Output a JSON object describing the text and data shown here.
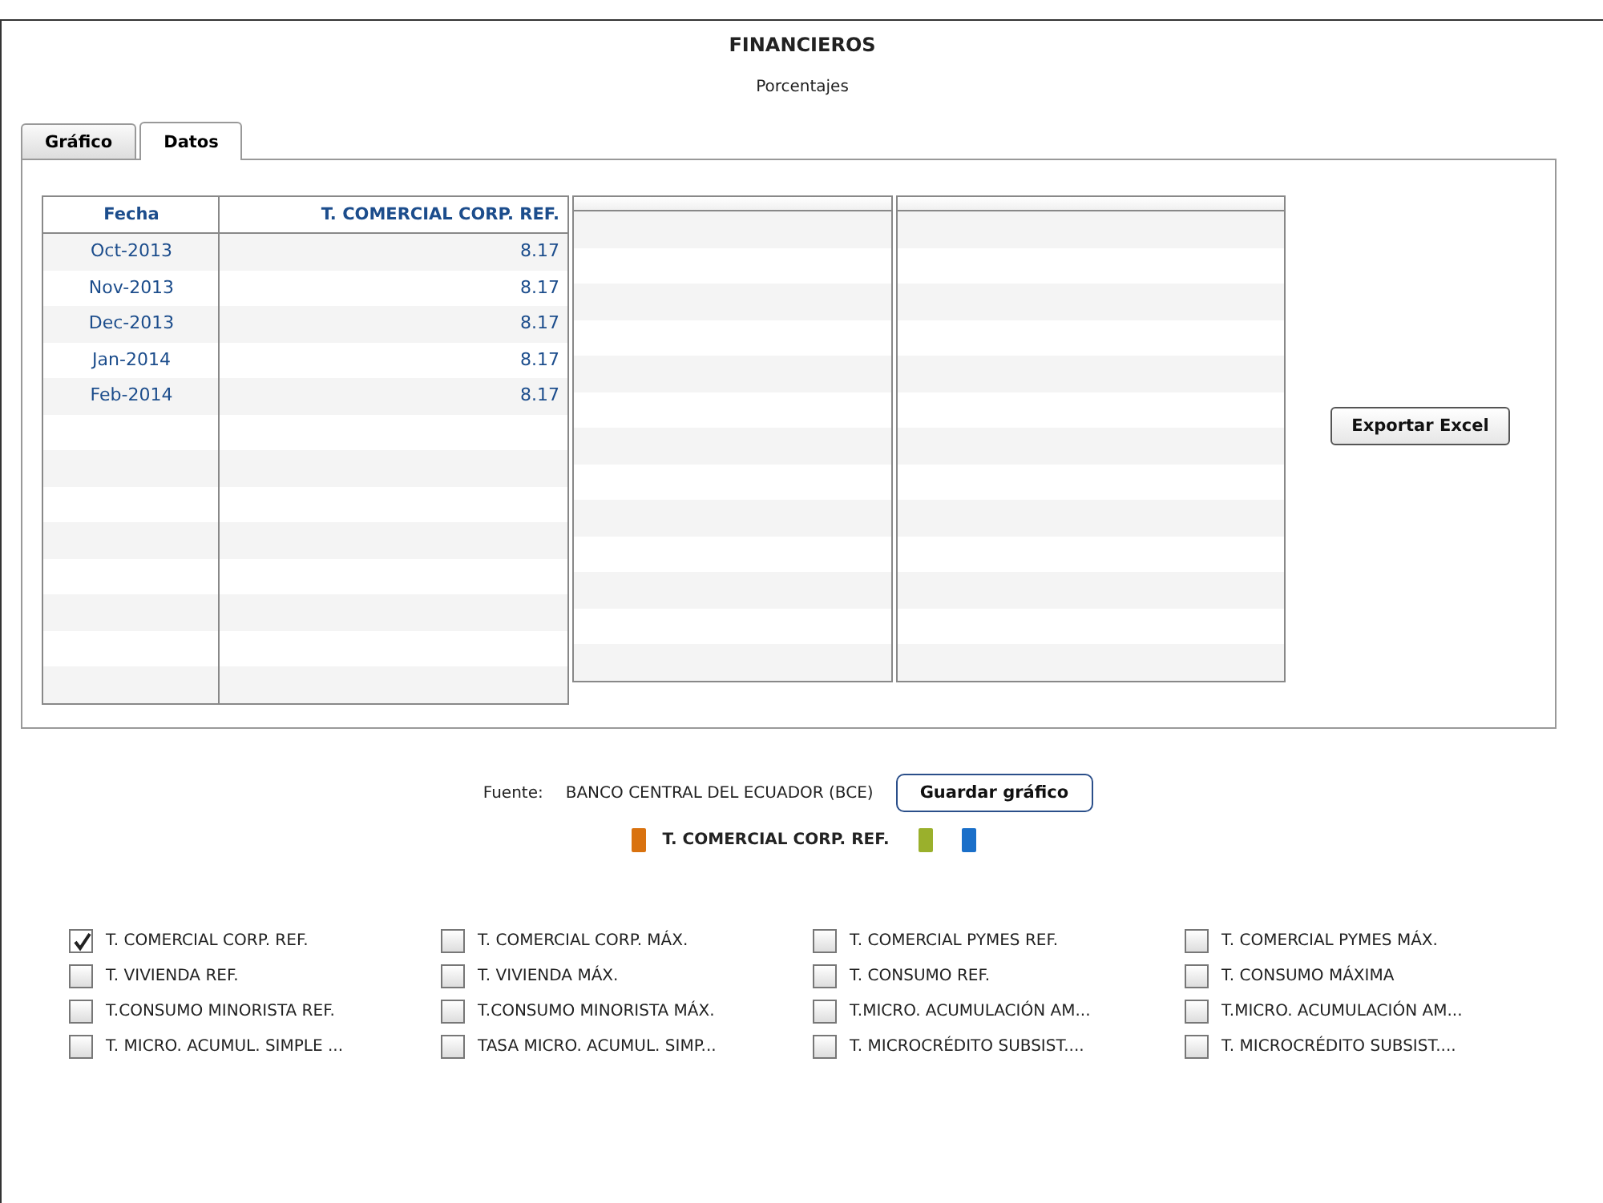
{
  "title": "FINANCIEROS",
  "subtitle": "Porcentajes",
  "tabs": [
    {
      "label": "Gráfico",
      "selected": false
    },
    {
      "label": "Datos",
      "selected": true
    }
  ],
  "table": {
    "columns": [
      "Fecha",
      "T. COMERCIAL CORP. REF."
    ],
    "rows": [
      [
        "Oct-2013",
        "8.17"
      ],
      [
        "Nov-2013",
        "8.17"
      ],
      [
        "Dec-2013",
        "8.17"
      ],
      [
        "Jan-2014",
        "8.17"
      ],
      [
        "Feb-2014",
        "8.17"
      ]
    ]
  },
  "export_button": "Exportar Excel",
  "source": {
    "label": "Fuente:",
    "value": "BANCO CENTRAL DEL ECUADOR (BCE)"
  },
  "save_button": "Guardar gráfico",
  "legend": [
    {
      "label": "T. COMERCIAL CORP. REF.",
      "color": "#d9720f"
    },
    {
      "color": "#9ab02c"
    },
    {
      "color": "#1a6fc9"
    }
  ],
  "series_options": [
    {
      "label": "T. COMERCIAL CORP. REF.",
      "checked": true
    },
    {
      "label": "T. COMERCIAL CORP. MÁX.",
      "checked": false
    },
    {
      "label": "T. COMERCIAL PYMES REF.",
      "checked": false
    },
    {
      "label": "T. COMERCIAL PYMES MÁX.",
      "checked": false
    },
    {
      "label": "T. VIVIENDA REF.",
      "checked": false
    },
    {
      "label": "T. VIVIENDA MÁX.",
      "checked": false
    },
    {
      "label": "T. CONSUMO REF.",
      "checked": false
    },
    {
      "label": "T. CONSUMO MÁXIMA",
      "checked": false
    },
    {
      "label": "T.CONSUMO MINORISTA REF.",
      "checked": false
    },
    {
      "label": "T.CONSUMO MINORISTA MÁX.",
      "checked": false
    },
    {
      "label": "T.MICRO. ACUMULACIÓN AM...",
      "checked": false
    },
    {
      "label": "T.MICRO. ACUMULACIÓN AM...",
      "checked": false
    },
    {
      "label": "T. MICRO. ACUMUL. SIMPLE ...",
      "checked": false
    },
    {
      "label": "TASA MICRO. ACUMUL. SIMP...",
      "checked": false
    },
    {
      "label": "T. MICROCRÉDITO SUBSIST....",
      "checked": false
    },
    {
      "label": "T. MICROCRÉDITO SUBSIST....",
      "checked": false
    }
  ]
}
